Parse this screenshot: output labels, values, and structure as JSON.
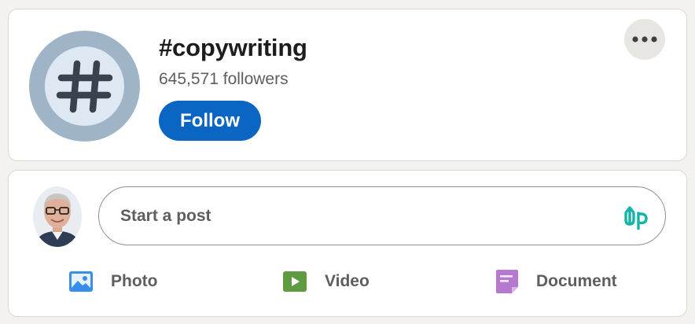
{
  "hashtag": {
    "title": "#copywriting",
    "followers": "645,571 followers",
    "follow_label": "Follow",
    "more_icon": "more-horizontal-icon",
    "avatar_icon": "hashtag-icon"
  },
  "composer": {
    "placeholder": "Start a post",
    "extension_icon": "up-arrow-logo-icon",
    "actions": [
      {
        "label": "Photo",
        "icon": "photo-icon",
        "color": "#378fe9"
      },
      {
        "label": "Video",
        "icon": "video-icon",
        "color": "#5f9b41"
      },
      {
        "label": "Document",
        "icon": "document-icon",
        "color": "#b57ad0"
      }
    ]
  },
  "colors": {
    "accent": "#0a66c2",
    "background": "#f4f2ee",
    "up_logo": "#12b5a7"
  }
}
